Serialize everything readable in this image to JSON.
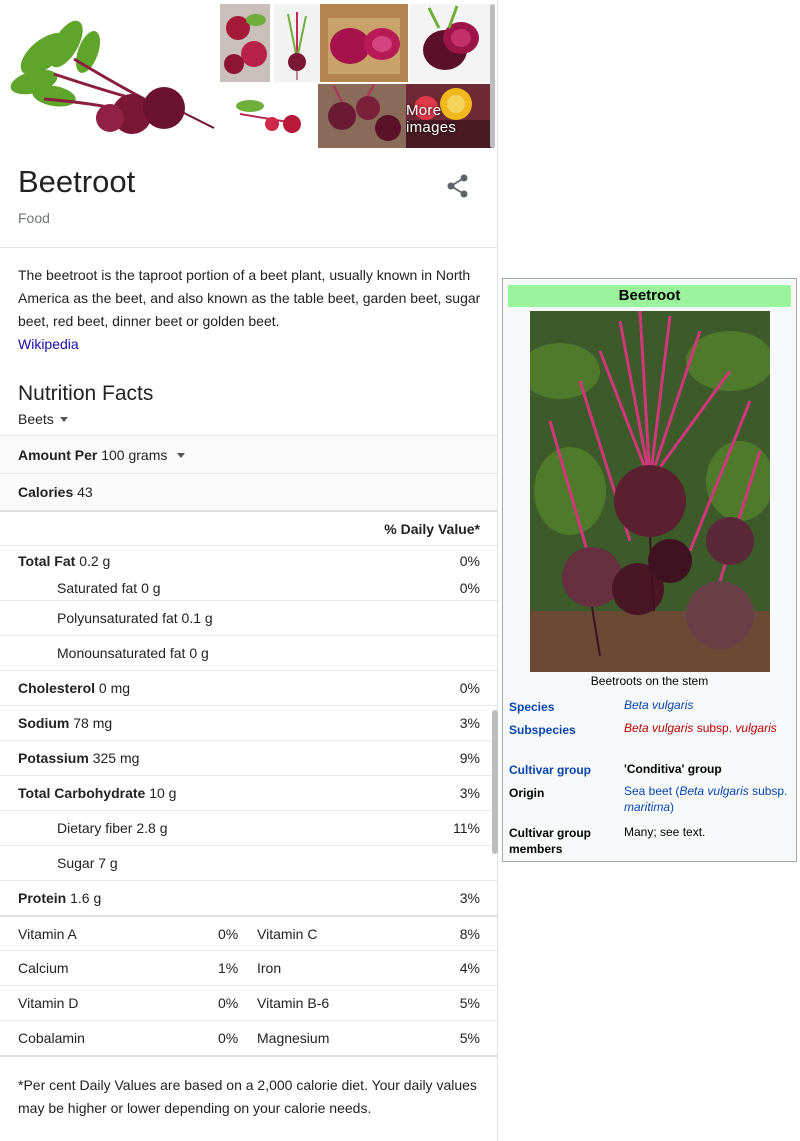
{
  "panel": {
    "more_images": "More images",
    "title": "Beetroot",
    "subtitle": "Food",
    "description": "The beetroot is the taproot portion of a beet plant, usually known in North America as the beet, and also known as the table beet, garden beet, sugar beet, red beet, dinner beet or golden beet.",
    "source_link": "Wikipedia"
  },
  "nutrition": {
    "heading": "Nutrition Facts",
    "food_select": "Beets",
    "amount_label": "Amount Per",
    "amount_value": "100 grams",
    "calories_label": "Calories",
    "calories_value": "43",
    "dv_header": "% Daily Value*",
    "rows": [
      {
        "label": "Total Fat",
        "value": "0.2 g",
        "pct": "0%"
      },
      {
        "label": "Saturated fat",
        "value": "0 g",
        "pct": "0%"
      },
      {
        "label": "Polyunsaturated fat",
        "value": "0.1 g",
        "pct": ""
      },
      {
        "label": "Monounsaturated fat",
        "value": "0 g",
        "pct": ""
      },
      {
        "label": "Cholesterol",
        "value": "0 mg",
        "pct": "0%"
      },
      {
        "label": "Sodium",
        "value": "78 mg",
        "pct": "3%"
      },
      {
        "label": "Potassium",
        "value": "325 mg",
        "pct": "9%"
      },
      {
        "label": "Total Carbohydrate",
        "value": "10 g",
        "pct": "3%"
      },
      {
        "label": "Dietary fiber",
        "value": "2.8 g",
        "pct": "11%"
      },
      {
        "label": "Sugar",
        "value": "7 g",
        "pct": ""
      },
      {
        "label": "Protein",
        "value": "1.6 g",
        "pct": "3%"
      }
    ],
    "vitamins": [
      {
        "a": "Vitamin A",
        "a_pct": "0%",
        "b": "Vitamin C",
        "b_pct": "8%"
      },
      {
        "a": "Calcium",
        "a_pct": "1%",
        "b": "Iron",
        "b_pct": "4%"
      },
      {
        "a": "Vitamin D",
        "a_pct": "0%",
        "b": "Vitamin B-6",
        "b_pct": "5%"
      },
      {
        "a": "Cobalamin",
        "a_pct": "0%",
        "b": "Magnesium",
        "b_pct": "5%"
      }
    ],
    "footnote": "*Per cent Daily Values are based on a 2,000 calorie diet. Your daily values may be higher or lower depending on your calorie needs."
  },
  "infobox": {
    "title": "Beetroot",
    "caption": "Beetroots on the stem",
    "species_key": "Species",
    "species_val": "Beta vulgaris",
    "subspecies_key": "Subspecies",
    "subspecies_val_italic": "Beta vulgaris",
    "subspecies_val_mid": " subsp. ",
    "subspecies_val_italic2": "vulgaris",
    "cultivar_key": "Cultivar group",
    "cultivar_val": "'Conditiva' group",
    "origin_key": "Origin",
    "origin_val_a": "Sea beet (",
    "origin_val_b": "Beta vulgaris",
    "origin_val_c": " subsp. ",
    "origin_val_d": "maritima",
    "origin_val_e": ")",
    "members_key": "Cultivar group members",
    "members_val": "Many; see text."
  },
  "colors": {
    "infobox_header": "#9bf49b",
    "link_blue": "#0645ad",
    "google_link": "#1a0dab",
    "redlink": "#ba0000"
  },
  "icons": [
    "share-icon",
    "chevron-down-icon"
  ]
}
